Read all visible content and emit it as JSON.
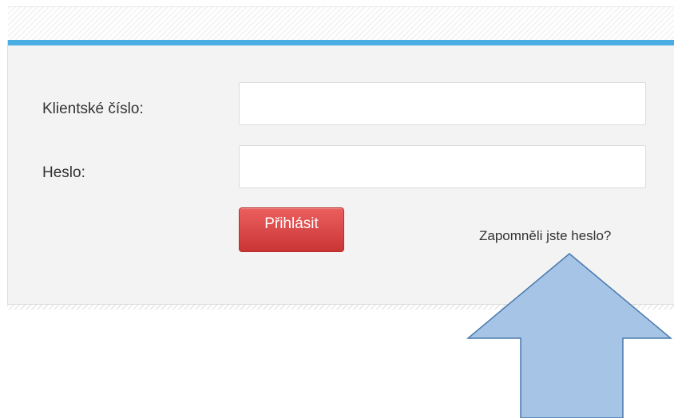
{
  "login_form": {
    "client_number_label": "Klientské číslo:",
    "client_number_value": "",
    "password_label": "Heslo:",
    "password_value": "",
    "login_button_label": "Přihlásit",
    "forgot_password_link": "Zapomněli jste heslo?"
  },
  "colors": {
    "accent": "#4aaee3",
    "login_button": "#d94444",
    "annotation_arrow_fill": "#a5c4e6",
    "annotation_arrow_stroke": "#4a79ad"
  },
  "annotation": {
    "arrow_icon": "up-arrow-icon",
    "points_to": "forgot_password_link"
  }
}
